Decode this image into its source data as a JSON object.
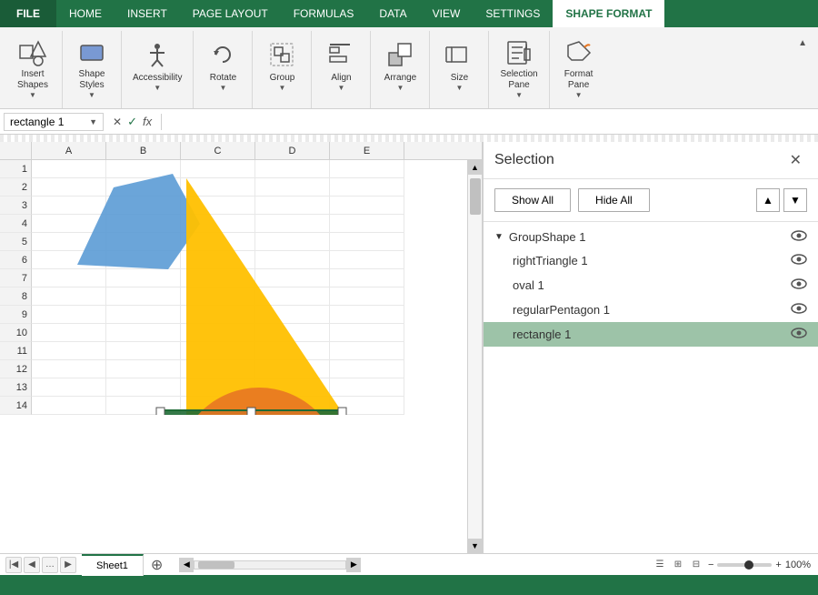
{
  "ribbon": {
    "file_label": "FILE",
    "tabs": [
      "HOME",
      "INSERT",
      "PAGE LAYOUT",
      "FORMULAS",
      "DATA",
      "VIEW",
      "SETTINGS",
      "SHAPE FORMAT"
    ],
    "active_tab": "SHAPE FORMAT",
    "groups": [
      {
        "label": "Insert Shapes",
        "items": [
          {
            "icon": "insert-shapes",
            "label": "Insert Shapes"
          }
        ]
      },
      {
        "label": "Shape Styles",
        "items": [
          {
            "icon": "shape-styles",
            "label": "Shape Styles"
          }
        ]
      },
      {
        "label": "Accessibility",
        "items": [
          {
            "icon": "accessibility",
            "label": "Accessibility"
          }
        ]
      },
      {
        "label": "Rotate",
        "items": [
          {
            "icon": "rotate",
            "label": "Rotate"
          }
        ]
      },
      {
        "label": "Group",
        "items": [
          {
            "icon": "group",
            "label": "Group"
          }
        ]
      },
      {
        "label": "Align",
        "items": [
          {
            "icon": "align",
            "label": "Align"
          }
        ]
      },
      {
        "label": "Arrange",
        "items": [
          {
            "icon": "arrange",
            "label": "Arrange"
          }
        ]
      },
      {
        "label": "Size",
        "items": [
          {
            "icon": "size",
            "label": "Size"
          }
        ]
      },
      {
        "label": "Selection Pane",
        "items": [
          {
            "icon": "selection-pane",
            "label": "Selection Pane"
          }
        ]
      },
      {
        "label": "Format Pane",
        "items": [
          {
            "icon": "format-pane",
            "label": "Format Pane"
          }
        ]
      }
    ]
  },
  "formula_bar": {
    "name_box_value": "rectangle 1",
    "fx_symbol": "fx",
    "cancel_symbol": "✕",
    "confirm_symbol": "✓",
    "formula_value": ""
  },
  "columns": [
    "A",
    "B",
    "C",
    "D",
    "E"
  ],
  "rows": [
    "1",
    "2",
    "3",
    "4",
    "5",
    "6",
    "7",
    "8",
    "9",
    "10",
    "11",
    "12",
    "13",
    "14"
  ],
  "selection_pane": {
    "title": "Selection",
    "close_icon": "✕",
    "show_all_label": "Show All",
    "hide_all_label": "Hide All",
    "up_arrow": "▲",
    "down_arrow": "▼",
    "items": [
      {
        "type": "group",
        "name": "GroupShape 1",
        "visible": true,
        "expanded": true
      },
      {
        "type": "item",
        "name": "rightTriangle 1",
        "visible": true,
        "selected": false
      },
      {
        "type": "item",
        "name": "oval 1",
        "visible": true,
        "selected": false
      },
      {
        "type": "item",
        "name": "regularPentagon 1",
        "visible": true,
        "selected": false
      },
      {
        "type": "item",
        "name": "rectangle 1",
        "visible": true,
        "selected": true
      }
    ]
  },
  "sheet_tabs": [
    "Sheet1"
  ],
  "active_sheet": "Sheet1",
  "status": "",
  "zoom": "100%"
}
